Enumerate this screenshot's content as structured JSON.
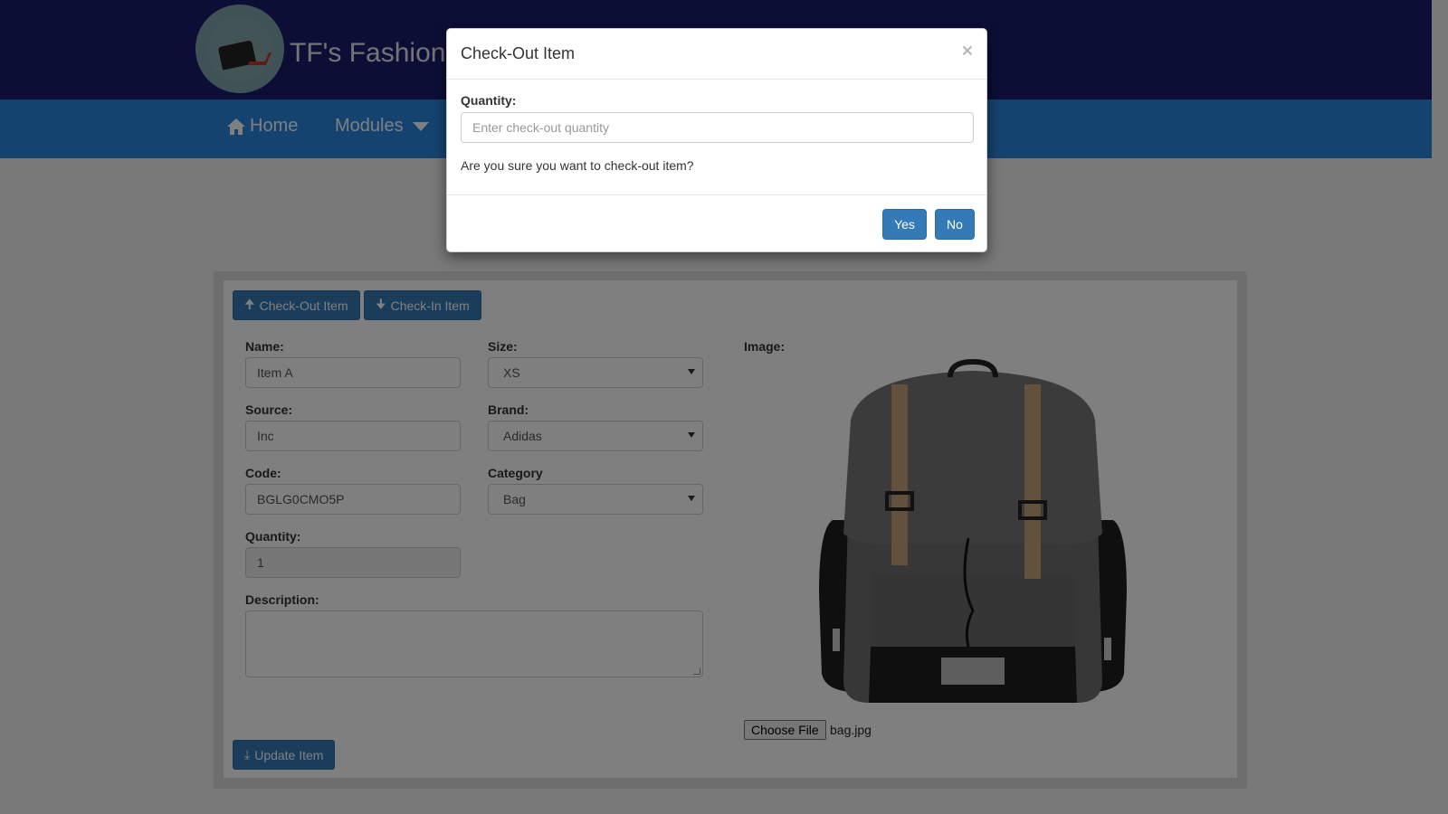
{
  "header": {
    "brand_title": "TF's Fashion"
  },
  "nav": {
    "home_label": "Home",
    "modules_label": "Modules"
  },
  "toolbar": {
    "checkout_label": "Check-Out Item",
    "checkin_label": "Check-In Item"
  },
  "form": {
    "name_label": "Name:",
    "name_value": "Item A",
    "size_label": "Size:",
    "size_value": "XS",
    "source_label": "Source:",
    "source_value": "Inc",
    "brand_label": "Brand:",
    "brand_value": "Adidas",
    "code_label": "Code:",
    "code_value": "BGLG0CMO5P",
    "category_label": "Category",
    "category_value": "Bag",
    "quantity_label": "Quantity:",
    "quantity_value": "1",
    "description_label": "Description:",
    "description_value": "",
    "image_label": "Image:",
    "choose_file_label": "Choose File",
    "file_name": "bag.jpg",
    "update_label": "Update Item"
  },
  "modal": {
    "title": "Check-Out Item",
    "close_glyph": "×",
    "quantity_label": "Quantity:",
    "quantity_placeholder": "Enter check-out quantity",
    "confirm_text": "Are you sure you want to check-out item?",
    "yes_label": "Yes",
    "no_label": "No"
  },
  "colors": {
    "header_bg": "#1b1c6b",
    "navbar_bg": "#2a86de",
    "primary_button": "#337ab7"
  }
}
